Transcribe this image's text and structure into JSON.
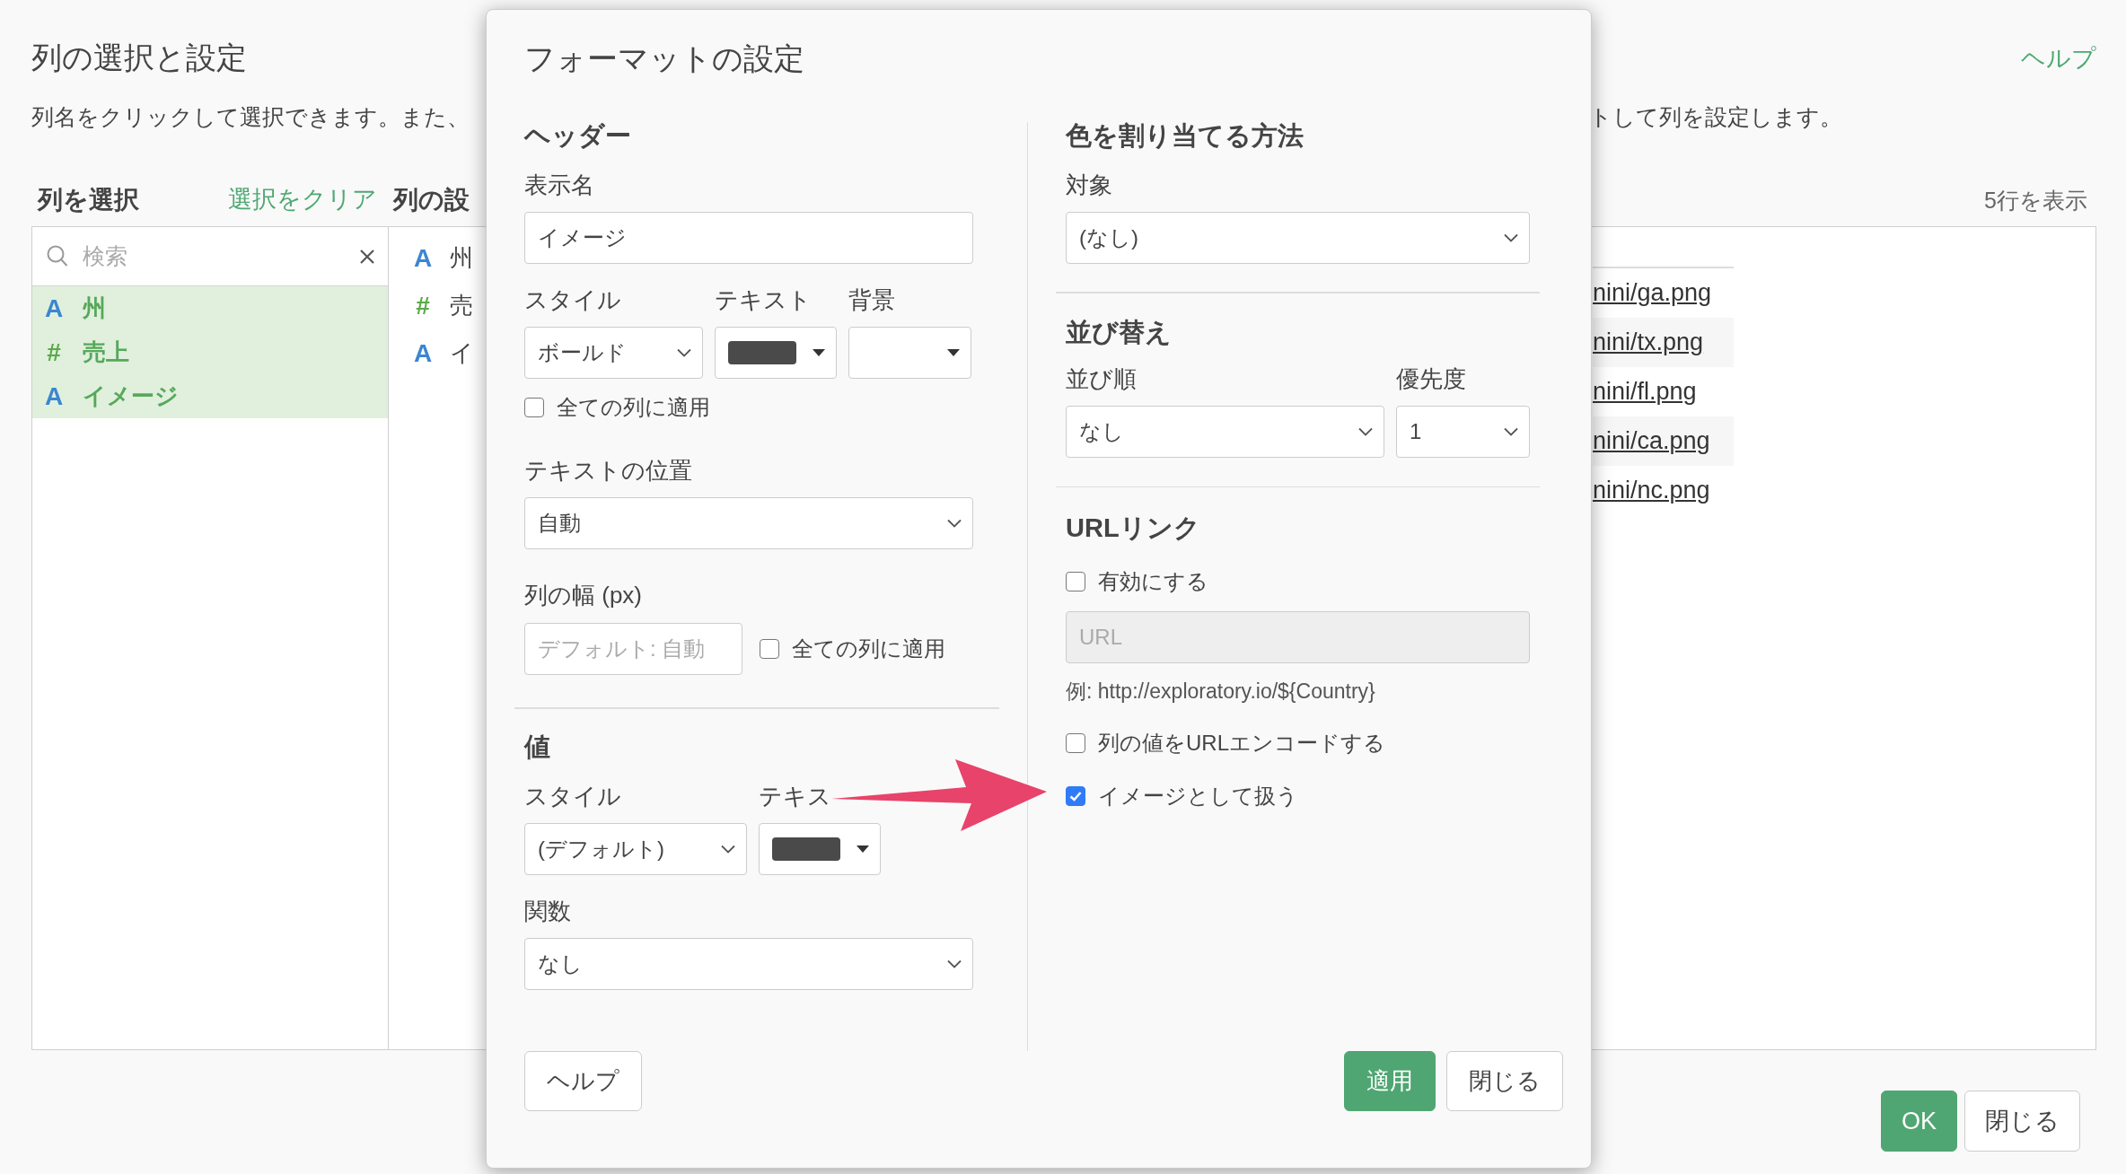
{
  "dialog": {
    "title": "列の選択と設定",
    "help_link": "ヘルプ",
    "description_start": "列名をクリックして選択できます。また、",
    "description_end": "トして列を設定します。",
    "select_columns": {
      "heading": "列を選択",
      "clear_link": "選択をクリア",
      "search": {
        "placeholder": "検索"
      },
      "items": [
        {
          "kind": "text",
          "icon": "A",
          "name": "州",
          "selected": true
        },
        {
          "kind": "number",
          "icon": "#",
          "name": "売上",
          "selected": true
        },
        {
          "kind": "text",
          "icon": "A",
          "name": "イメージ",
          "selected": true
        }
      ]
    },
    "column_settings": {
      "heading": "列の設",
      "items": [
        {
          "kind": "text",
          "icon": "A",
          "name": "州"
        },
        {
          "kind": "number",
          "icon": "#",
          "name": "売"
        },
        {
          "kind": "text",
          "icon": "A",
          "name": "イ"
        }
      ]
    },
    "preview": {
      "row_count": "5行を表示",
      "rows": [
        "nini/ga.png",
        "nini/tx.png",
        "nini/fl.png",
        "nini/ca.png",
        "nini/nc.png"
      ]
    },
    "buttons": [
      {
        "label": "OK",
        "primary": true
      },
      {
        "label": "閉じる",
        "primary": false
      }
    ]
  },
  "format_modal": {
    "title": "フォーマットの設定",
    "header": {
      "heading": "ヘッダー",
      "display_name": {
        "label": "表示名",
        "value": "イメージ"
      },
      "style": {
        "label": "スタイル",
        "value": "ボールド"
      },
      "text_color": {
        "label": "テキスト",
        "color": "#4a4a4a"
      },
      "background": {
        "label": "背景"
      },
      "apply_all": {
        "label": "全ての列に適用",
        "checked": false
      },
      "text_position": {
        "label": "テキストの位置",
        "value": "自動"
      },
      "column_width": {
        "label": "列の幅 (px)",
        "placeholder": "デフォルト: 自動"
      },
      "width_apply_all": {
        "label": "全ての列に適用",
        "checked": false
      }
    },
    "value": {
      "heading": "値",
      "style": {
        "label": "スタイル",
        "value": "(デフォルト)"
      },
      "text_color": {
        "label": "テキス",
        "color": "#4a4a4a"
      },
      "function": {
        "label": "関数",
        "value": "なし"
      }
    },
    "color_assign": {
      "heading": "色を割り当てる方法",
      "target": {
        "label": "対象",
        "value": "(なし)"
      }
    },
    "sort": {
      "heading": "並び替え",
      "order": {
        "label": "並び順",
        "value": "なし"
      },
      "priority": {
        "label": "優先度",
        "value": "1"
      }
    },
    "url_link": {
      "heading": "URLリンク",
      "enable": {
        "label": "有効にする",
        "checked": false
      },
      "url": {
        "placeholder": "URL",
        "disabled": true
      },
      "example": "例: http://exploratory.io/${Country}",
      "encode": {
        "label": "列の値をURLエンコードする",
        "checked": false
      },
      "as_image": {
        "label": "イメージとして扱う",
        "checked": true
      }
    },
    "buttons": [
      {
        "label": "ヘルプ",
        "primary": false
      },
      {
        "label": "適用",
        "primary": true
      },
      {
        "label": "閉じる",
        "primary": false
      }
    ]
  }
}
